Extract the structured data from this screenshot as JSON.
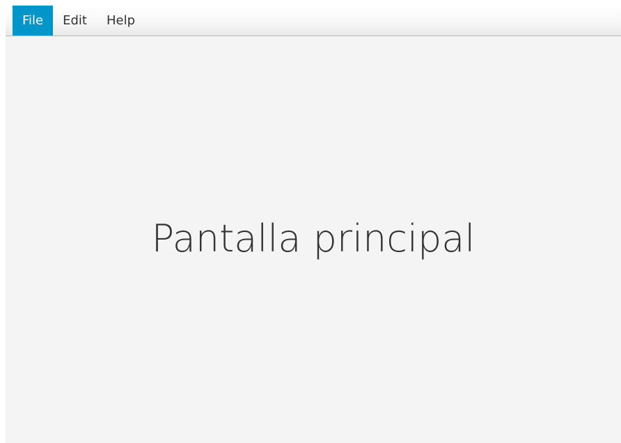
{
  "menubar": {
    "items": [
      {
        "label": "File",
        "active": true
      },
      {
        "label": "Edit",
        "active": false
      },
      {
        "label": "Help",
        "active": false
      }
    ],
    "active_color": "#0096c9"
  },
  "main": {
    "heading": "Pantalla principal"
  }
}
